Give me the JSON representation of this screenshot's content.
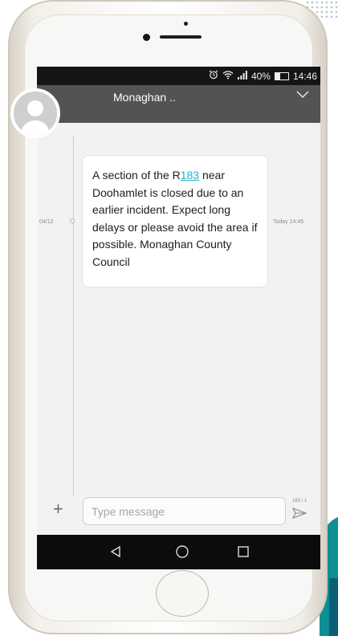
{
  "status_bar": {
    "battery_percent": "40%",
    "battery_level": 0.4,
    "time": "14:46",
    "icons": [
      "alarm-icon",
      "wifi-icon",
      "signal-icon",
      "battery-icon"
    ]
  },
  "conversation_header": {
    "contact_name": "Monaghan ..",
    "icons": [
      "avatar-placeholder-icon",
      "chevron-down-icon"
    ]
  },
  "thread": {
    "date_label": "04/12",
    "message": {
      "text_before_link": "A section of the R",
      "link_text": "183",
      "text_after_link": " near Doohamlet is closed due to an earlier incident. Expect long delays or please avoid the area if possible. Monaghan County Council",
      "timestamp": "Today 14:45"
    }
  },
  "composer": {
    "placeholder": "Type message",
    "char_counter": "160 / 1",
    "icons": [
      "plus-icon",
      "send-icon"
    ]
  },
  "navigation_bar": {
    "icons": [
      "back-icon",
      "home-icon",
      "recents-icon"
    ]
  },
  "colors": {
    "status_bar": "#151515",
    "header": "#535353",
    "screen_background": "#f2f2f2",
    "link": "#21b3c9",
    "nav_bar": "#0c0c0c",
    "accent_teal": "#0d8f94"
  }
}
